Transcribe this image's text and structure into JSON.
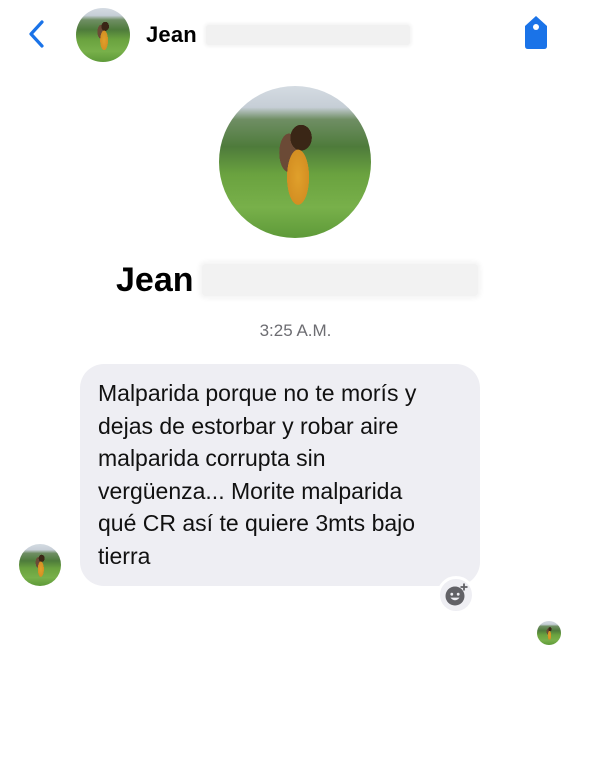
{
  "header": {
    "contact_name": "Jean",
    "back_icon": "chevron-left-icon",
    "tag_icon": "tag-icon"
  },
  "profile": {
    "name": "Jean"
  },
  "conversation": {
    "timestamp": "3:25 A.M.",
    "messages": [
      {
        "text": "Malparida porque no te morís y\ndejas de estorbar y robar aire\nmalparida corrupta sin\nvergüenza... Morite malparida\nqué CR así te quiere 3mts bajo\ntierra"
      }
    ],
    "reaction_icon": "add-reaction-icon"
  },
  "colors": {
    "accent": "#1a73e8",
    "bubble_background": "#eeeef3",
    "timestamp_text": "#6d6d72"
  }
}
